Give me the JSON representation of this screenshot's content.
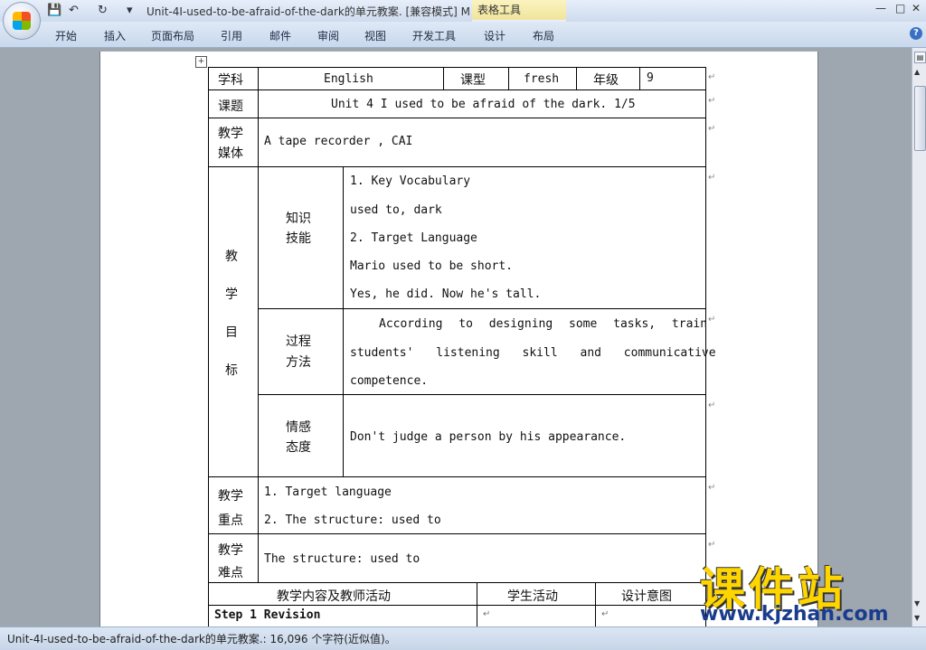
{
  "window": {
    "title": "Unit-4I-used-to-be-afraid-of-the-dark的单元教案. [兼容模式] M",
    "context_tab": "表格工具",
    "minimize": "—",
    "restore": "□",
    "close": "✕"
  },
  "quick_access": {
    "save": "💾",
    "undo": "↶",
    "redo": "↻",
    "more": "▾"
  },
  "ribbon": {
    "tabs": [
      "开始",
      "插入",
      "页面布局",
      "引用",
      "邮件",
      "审阅",
      "视图",
      "开发工具",
      "设计",
      "布局"
    ],
    "help": "?"
  },
  "status": {
    "text": "Unit-4I-used-to-be-afraid-of-the-dark的单元教案.: 16,096 个字符(近似值)。"
  },
  "mark": "↵",
  "table": {
    "subject_label": "学科",
    "subject": "English",
    "type_label": "课型",
    "type": "fresh",
    "grade_label": "年级",
    "grade": "9",
    "topic_label": "课题",
    "topic": "Unit 4 I used to be afraid of the dark.   1/5",
    "media_label_1": "教学",
    "media_label_2": "媒体",
    "media": "A tape recorder , CAI",
    "goal_label": [
      "教",
      "学",
      "目",
      "标"
    ],
    "knowledge_label_1": "知识",
    "knowledge_label_2": "技能",
    "knowledge": [
      "1. Key Vocabulary",
      "used to, dark",
      "2. Target Language",
      "Mario used to be short.",
      "Yes, he did. Now he's tall."
    ],
    "process_label_1": "过程",
    "process_label_2": "方法",
    "process": [
      "According to designing some tasks, train",
      "students' listening skill and communicative",
      "competence."
    ],
    "emotion_label_1": "情感",
    "emotion_label_2": "态度",
    "emotion": "Don't judge a person by his appearance.",
    "key_label_1": "教学",
    "key_label_2": "重点",
    "key": [
      "1. Target language",
      "2. The structure: used to"
    ],
    "diff_label_1": "教学",
    "diff_label_2": "难点",
    "diff": "The structure: used to",
    "col_teacher": "教学内容及教师活动",
    "col_student": "学生活动",
    "col_design": "设计意图",
    "step1": "Step 1 Revision"
  },
  "watermark": {
    "title": "课件站",
    "url": "www.kjzhan.com"
  }
}
